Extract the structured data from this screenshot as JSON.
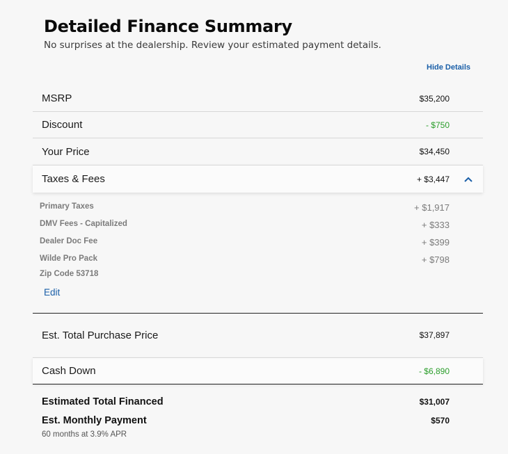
{
  "header": {
    "title": "Detailed Finance Summary",
    "subtitle": "No surprises at the dealership. Review your estimated payment details.",
    "hide_details": "Hide Details"
  },
  "rows": {
    "msrp": {
      "label": "MSRP",
      "value": "$35,200"
    },
    "discount": {
      "label": "Discount",
      "value": "- $750"
    },
    "your_price": {
      "label": "Your Price",
      "value": "$34,450"
    },
    "taxes_fees": {
      "label": "Taxes & Fees",
      "value": "+ $3,447"
    }
  },
  "tax_details": [
    {
      "label": "Primary Taxes",
      "value": "+ $1,917"
    },
    {
      "label": "DMV Fees - Capitalized",
      "value": "+ $333"
    },
    {
      "label": "Dealer Doc Fee",
      "value": "+ $399"
    },
    {
      "label": "Wilde Pro Pack",
      "value": "+ $798"
    }
  ],
  "zip": "Zip Code 53718",
  "edit_label": "Edit",
  "total_purchase": {
    "label": "Est. Total Purchase Price",
    "value": "$37,897"
  },
  "cash_down": {
    "label": "Cash Down",
    "value": "- $6,890"
  },
  "summary": {
    "financed": {
      "label": "Estimated Total Financed",
      "value": "$31,007"
    },
    "monthly": {
      "label": "Est. Monthly Payment",
      "value": "$570"
    },
    "term_note": "60 months at 3.9% APR"
  },
  "colors": {
    "link": "#1a5fa8",
    "discount_green": "#2a9d2a"
  },
  "icons": {
    "collapse": "chevron-up-icon"
  }
}
